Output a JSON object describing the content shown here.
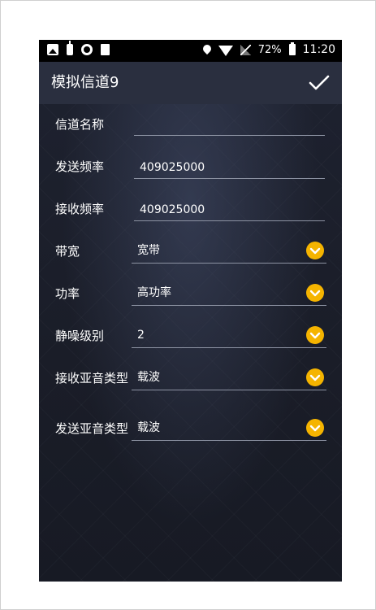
{
  "status_bar": {
    "battery_percent": "72%",
    "time": "11:20",
    "icons": [
      "image-icon",
      "walkie-talkie-icon",
      "disc-icon",
      "document-icon",
      "location-icon",
      "wifi-icon",
      "no-signal-icon",
      "battery-charging-icon"
    ]
  },
  "toolbar": {
    "title": "模拟信道9",
    "confirm_icon": "check-icon"
  },
  "form": {
    "channel_name": {
      "label": "信道名称",
      "value": ""
    },
    "tx_frequency": {
      "label": "发送频率",
      "value": "409025000"
    },
    "rx_frequency": {
      "label": "接收频率",
      "value": "409025000"
    },
    "bandwidth": {
      "label": "带宽",
      "value": "宽带"
    },
    "power": {
      "label": "功率",
      "value": "高功率"
    },
    "squelch_level": {
      "label": "静噪级别",
      "value": "2"
    },
    "rx_subaudio_type": {
      "label": "接收亚音类型",
      "value": "载波"
    },
    "tx_subaudio_type": {
      "label": "发送亚音类型",
      "value": "载波"
    }
  },
  "colors": {
    "accent": "#f5b400",
    "toolbar_bg": "#2a2f3f",
    "background": "#1c202c",
    "underline": "#8d93a3"
  }
}
